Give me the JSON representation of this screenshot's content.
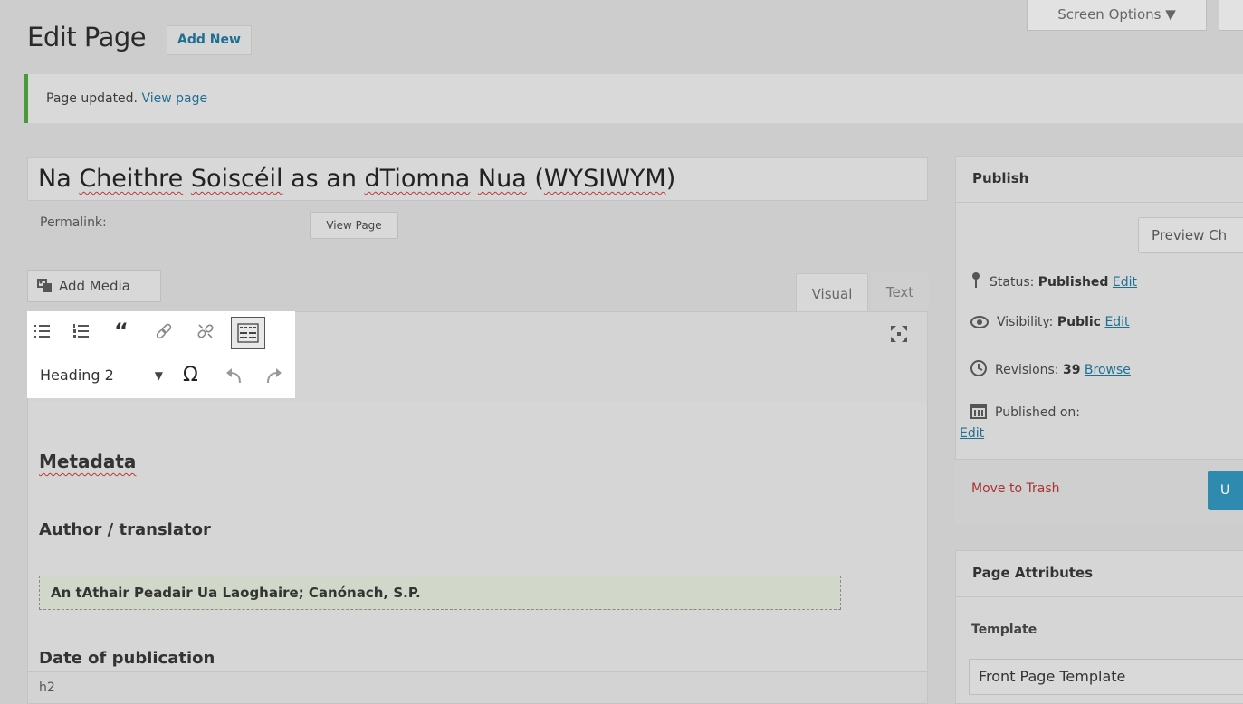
{
  "header": {
    "screen_options": "Screen Options ▼",
    "page_title": "Edit Page",
    "add_new": "Add New"
  },
  "notice": {
    "text": "Page updated.",
    "link": "View page"
  },
  "post": {
    "title_parts": [
      "Na ",
      "Cheithre",
      " ",
      "Soiscéil",
      " as an ",
      "dTiomna",
      " ",
      "Nua",
      " (",
      "WYSIWYM",
      ")"
    ],
    "permalink_label": "Permalink:",
    "view_page_button": "View Page"
  },
  "editor": {
    "add_media": "Add Media",
    "tab_visual": "Visual",
    "tab_text": "Text",
    "toolbar_icons": [
      "bullet-list-icon",
      "numbered-list-icon",
      "blockquote-icon",
      "insert-link-icon",
      "remove-link-icon",
      "toolbar-toggle-icon",
      "fullscreen-icon"
    ],
    "format_select": "Heading 2",
    "special_char": "Ω",
    "content": {
      "h_metadata": "Metadata",
      "h_author": "Author / translator",
      "author_value": "An tAthair Peadair Ua Laoghaire; Canónach, S.P.",
      "h_date": "Date of publication"
    },
    "status_path": "h2"
  },
  "publish": {
    "title": "Publish",
    "preview_button": "Preview Ch",
    "status_label": "Status:",
    "status_value": "Published",
    "status_edit": "Edit",
    "visibility_label": "Visibility:",
    "visibility_value": "Public",
    "visibility_edit": "Edit",
    "revisions_label": "Revisions:",
    "revisions_value": "39",
    "revisions_browse": "Browse",
    "published_on_label": "Published on:",
    "published_on_edit": "Edit",
    "trash": "Move to Trash",
    "update_button": "U"
  },
  "attributes": {
    "title": "Page Attributes",
    "template_label": "Template",
    "template_value": "Front Page Template"
  },
  "colors": {
    "link": "#1f6f93",
    "notice_border": "#4a9a3a",
    "primary_button": "#2f8ab0",
    "trash": "#aa3333"
  }
}
